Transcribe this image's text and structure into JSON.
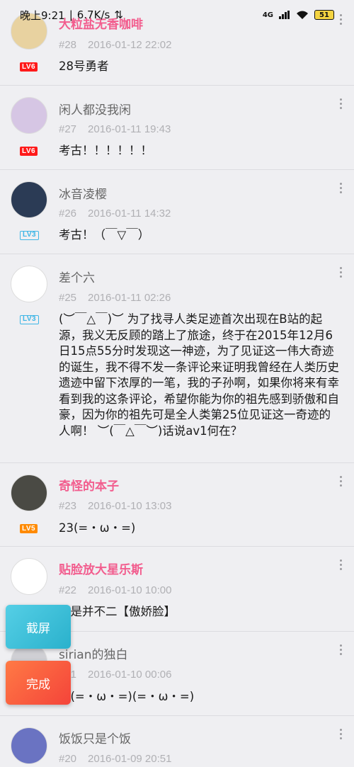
{
  "status_bar": {
    "time": "晚上9:21",
    "network_speed": "6.7K/s",
    "signal_text": "4G",
    "battery": "51"
  },
  "comments": [
    {
      "username": "大粒盐无香咖啡",
      "vip": true,
      "floor": "#28",
      "date": "2016-01-12 22:02",
      "level": "LV6",
      "level_style": "red",
      "content": "28号勇者",
      "avatar_color": "#e8d2a0"
    },
    {
      "username": "闲人都没我闲",
      "vip": false,
      "floor": "#27",
      "date": "2016-01-11 19:43",
      "level": "LV6",
      "level_style": "red",
      "content": "考古！！！！！！",
      "avatar_color": "#d6c6e4"
    },
    {
      "username": "冰音凌樱",
      "vip": false,
      "floor": "#26",
      "date": "2016-01-11 14:32",
      "level": "LV3",
      "level_style": "blue",
      "content": "考古！（￣▽￣）",
      "avatar_color": "#2b3b55"
    },
    {
      "username": "差个六",
      "vip": false,
      "floor": "#25",
      "date": "2016-01-11 02:26",
      "level": "LV3",
      "level_style": "blue",
      "content": "(︶￣△￣)︶ 为了找寻人类足迹首次出现在B站的起源，我义无反顾的踏上了旅途，终于在2015年12月6日15点55分时发现这一神迹，为了见证这一伟大奇迹的诞生，我不得不发一条评论来证明我曾经在人类历史遗迹中留下浓厚的一笔，我的子孙啊，如果你将来有幸看到我的这条评论，希望你能为你的祖先感到骄傲和自豪，因为你的祖先可是全人类第25位见证这一奇迹的人啊！ ︶(￣△￣︶)话说av1何在？",
      "avatar_color": "#ffffff"
    },
    {
      "username": "奇怪的本子",
      "vip": true,
      "floor": "#23",
      "date": "2016-01-10 13:03",
      "level": "LV5",
      "level_style": "orange",
      "content": "23(=・ω・=)",
      "avatar_color": "#4a4a44"
    },
    {
      "username": "贴脸放大星乐斯",
      "vip": true,
      "floor": "#22",
      "date": "2016-01-10 10:00",
      "level": "",
      "level_style": "none",
      "content": "但是并不二【傲娇脸】",
      "avatar_color": "#ffffff"
    },
    {
      "username": "sirian的独白",
      "vip": false,
      "floor": "#21",
      "date": "2016-01-10 00:06",
      "level": "",
      "level_style": "none",
      "content": "名(=・ω・=)(=・ω・=)",
      "avatar_color": "#cfcfd4"
    },
    {
      "username": "饭饭只是个饭",
      "vip": false,
      "floor": "#20",
      "date": "2016-01-09 20:51",
      "level": "",
      "level_style": "none",
      "content": "",
      "avatar_color": "#6a73c2"
    }
  ],
  "floating": {
    "screenshot_label": "截屏",
    "done_label": "完成"
  }
}
